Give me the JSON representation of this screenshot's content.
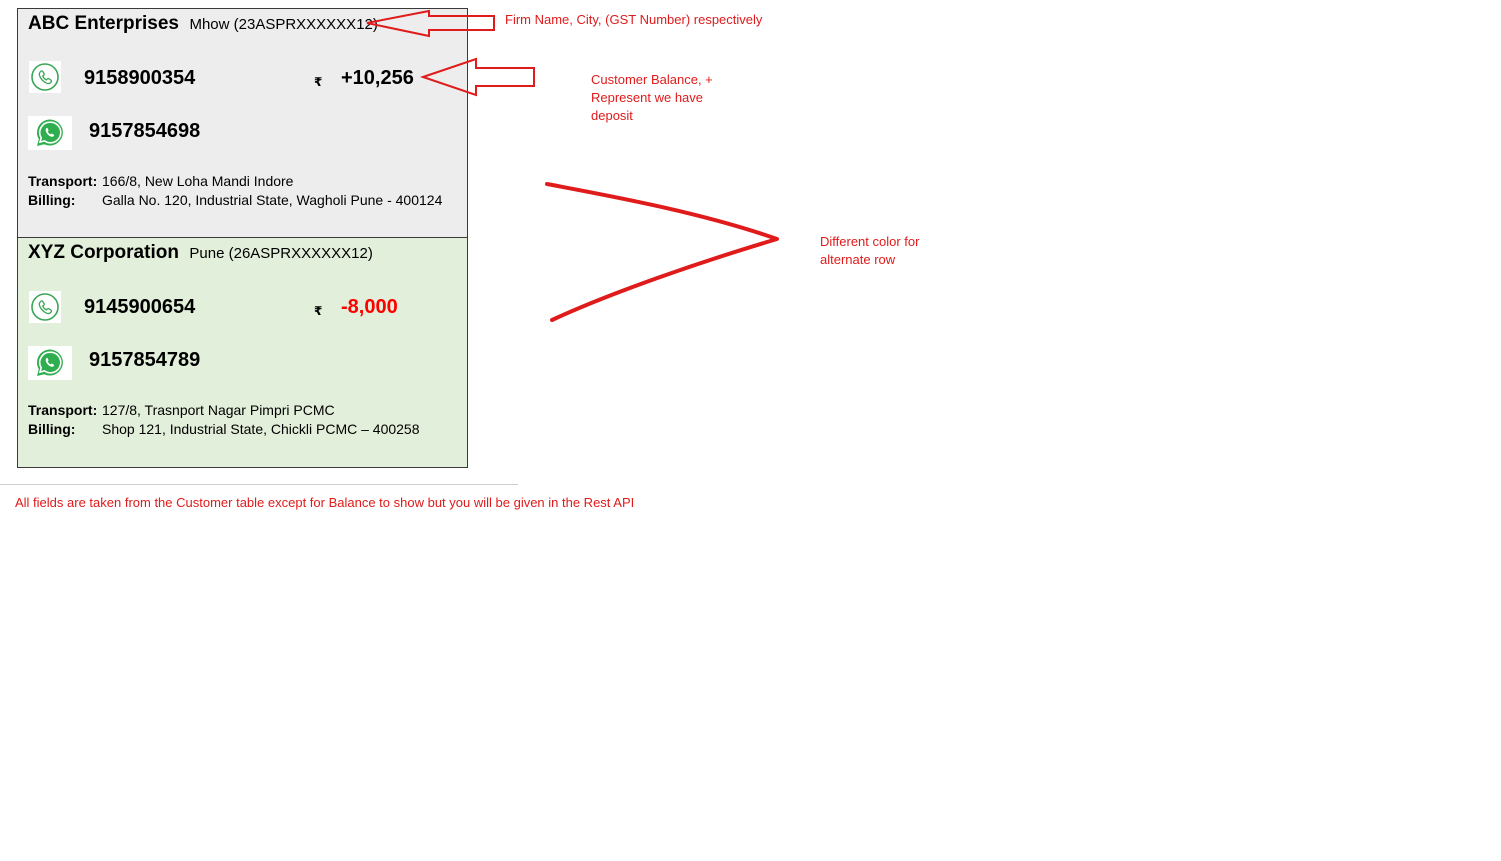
{
  "customers": [
    {
      "firm_name": "ABC Enterprises",
      "city_gst": "Mhow (23ASPRXXXXXX12)",
      "phone": "9158900354",
      "whatsapp": "9157854698",
      "currency_symbol": "₹",
      "balance": "+10,256",
      "transport_label": "Transport:",
      "transport": "166/8, New Loha Mandi Indore",
      "billing_label": "Billing:",
      "billing": "Galla No. 120, Industrial State, Wagholi Pune - 400124",
      "row_color": "#ededed"
    },
    {
      "firm_name": "XYZ Corporation",
      "city_gst": "Pune (26ASPRXXXXXX12)",
      "phone": "9145900654",
      "whatsapp": "9157854789",
      "currency_symbol": "₹",
      "balance": "-8,000",
      "transport_label": "Transport:",
      "transport": "127/8, Trasnport Nagar Pimpri PCMC",
      "billing_label": "Billing:",
      "billing": "Shop 121, Industrial State, Chickli PCMC – 400258",
      "row_color": "#e2efda",
      "balance_color": "#ff0000"
    }
  ],
  "annotations": {
    "firm_note": "Firm Name, City, (GST Number) respectively",
    "balance_note_1": "Customer Balance, +",
    "balance_note_2": "Represent we have",
    "balance_note_3": "deposit",
    "alt_row_note_1": "Different color for",
    "alt_row_note_2": "alternate row",
    "footer_note": "All fields are taken from the Customer table except for Balance to show but you will be given in the Rest API"
  },
  "icons": {
    "phone": "phone-icon",
    "whatsapp": "whatsapp-icon"
  },
  "colors": {
    "annotation": "#e01b1b",
    "negative_balance": "#ff0000",
    "icon_green": "#25a244"
  }
}
